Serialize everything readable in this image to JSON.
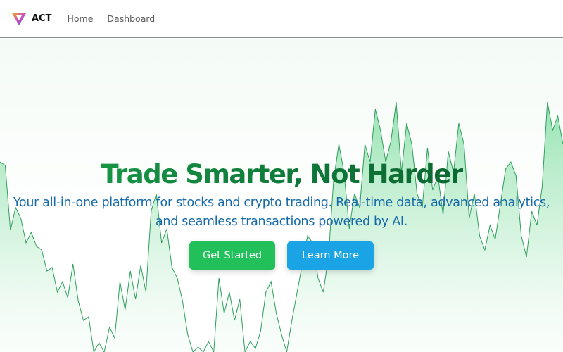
{
  "navbar": {
    "brand": "ACT",
    "links": [
      {
        "label": "Home"
      },
      {
        "label": "Dashboard"
      }
    ]
  },
  "hero": {
    "title": "Trade Smarter, Not Harder",
    "subtitle": "Your all-in-one platform for stocks and crypto trading. Real-time data, advanced analytics, and seamless transactions powered by AI.",
    "primary_button": "Get Started",
    "secondary_button": "Learn More"
  },
  "colors": {
    "title_gradient": [
      "#1aa34a",
      "#0a5c2c"
    ],
    "subtitle": "#1669a8",
    "primary_button": "#22c05b",
    "secondary_button": "#1aa4e6",
    "chart_line": "#2f9e5c",
    "chart_fill": "#86dfa6"
  },
  "icons": {
    "logo": "act-logo-icon"
  }
}
